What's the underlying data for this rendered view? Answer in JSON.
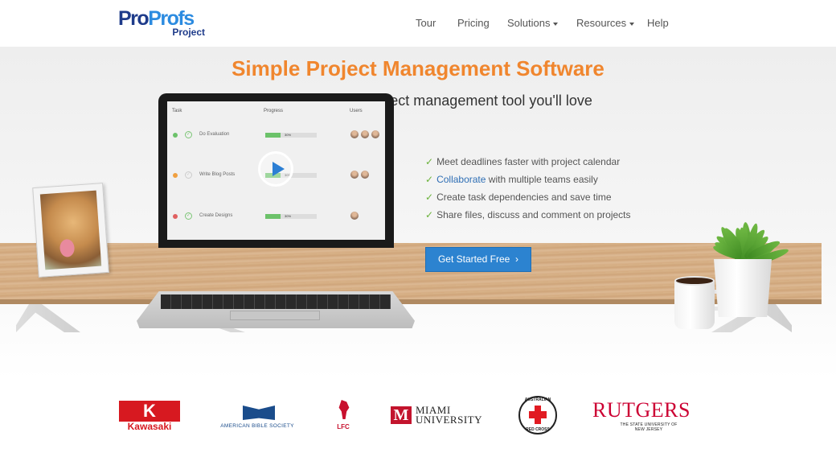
{
  "brand": {
    "name_part1": "Pro",
    "name_part2": "Profs",
    "product": "Project"
  },
  "nav": {
    "items": [
      {
        "label": "Tour",
        "dropdown": false
      },
      {
        "label": "Pricing",
        "dropdown": false
      },
      {
        "label": "Solutions",
        "dropdown": true
      },
      {
        "label": "Resources",
        "dropdown": true
      },
      {
        "label": "Help",
        "dropdown": false
      }
    ]
  },
  "hero": {
    "title": "Simple Project Management Software",
    "subtitle": "Easy to use online project management tool you'll love"
  },
  "app_preview": {
    "headers": {
      "task": "Task",
      "progress": "Progress",
      "users": "Users"
    },
    "rows": [
      {
        "task": "Do Evaluation",
        "progress_label": "30%",
        "progress": 0.3,
        "dot_color": "#6cc26a"
      },
      {
        "task": "Write Blog Posts",
        "progress_label": "30%",
        "progress": 0.3,
        "dot_color": "#f0a040"
      },
      {
        "task": "Create Designs",
        "progress_label": "30%",
        "progress": 0.3,
        "dot_color": "#e06060"
      }
    ]
  },
  "features": {
    "items": [
      {
        "text": "Meet deadlines faster with project calendar"
      },
      {
        "link": "Collaborate",
        "text": " with multiple teams easily"
      },
      {
        "text": "Create task dependencies and save time"
      },
      {
        "text": "Share files, discuss and comment on projects"
      }
    ]
  },
  "cta": {
    "label": "Get Started Free"
  },
  "clients": {
    "kawasaki": "Kawasaki",
    "abs": "AMERICAN BIBLE SOCIETY",
    "lfc": "LFC",
    "miami_line1": "MIAMI",
    "miami_line2": "UNIVERSITY",
    "redcross_line1": "AUSTRALIAN",
    "redcross_line2": "RED CROSS",
    "rutgers": "RUTGERS",
    "rutgers_sub": "THE STATE UNIVERSITY OF NEW JERSEY"
  },
  "colors": {
    "accent_orange": "#f0862e",
    "cta_blue": "#2c83d0",
    "check_green": "#6ab23a",
    "brand_navy": "#1e3b8a",
    "brand_blue": "#2c8be0"
  }
}
